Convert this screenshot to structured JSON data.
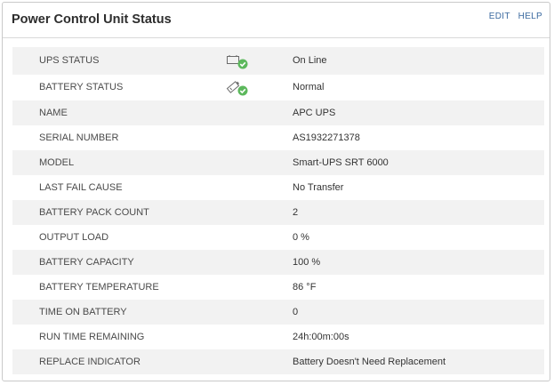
{
  "panel": {
    "title": "Power Control Unit Status",
    "actions": {
      "edit": "EDIT",
      "help": "HELP"
    }
  },
  "rows": [
    {
      "label": "UPS STATUS",
      "value": "On Line",
      "icon": "ups-online-check-icon"
    },
    {
      "label": "BATTERY STATUS",
      "value": "Normal",
      "icon": "battery-normal-check-icon"
    },
    {
      "label": "NAME",
      "value": "APC UPS"
    },
    {
      "label": "SERIAL NUMBER",
      "value": "AS1932271378"
    },
    {
      "label": "MODEL",
      "value": "Smart-UPS SRT 6000"
    },
    {
      "label": "LAST FAIL CAUSE",
      "value": "No Transfer"
    },
    {
      "label": "BATTERY PACK COUNT",
      "value": "2"
    },
    {
      "label": "OUTPUT LOAD",
      "value": "0 %"
    },
    {
      "label": "BATTERY CAPACITY",
      "value": "100 %"
    },
    {
      "label": "BATTERY TEMPERATURE",
      "value": "86 °F"
    },
    {
      "label": "TIME ON BATTERY",
      "value": "0"
    },
    {
      "label": "RUN TIME REMAINING",
      "value": "24h:00m:00s"
    },
    {
      "label": "REPLACE INDICATOR",
      "value": "Battery Doesn't Need Replacement"
    }
  ],
  "colors": {
    "check_green": "#5cb85c",
    "link_blue": "#3b6aa0",
    "stripe": "#f2f2f2"
  }
}
